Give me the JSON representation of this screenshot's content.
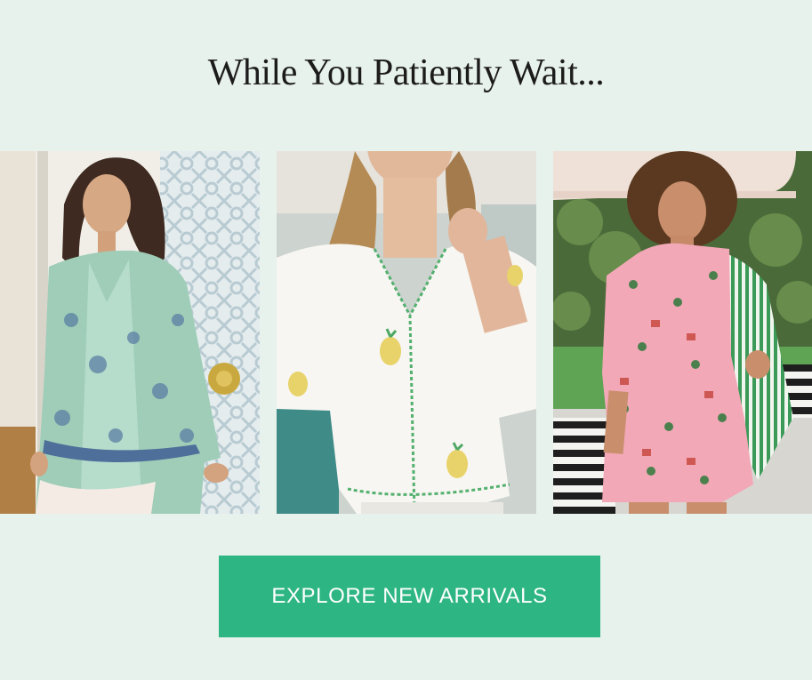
{
  "headline": "While You Patiently Wait...",
  "cta": {
    "label": "EXPLORE NEW ARRIVALS"
  },
  "colors": {
    "background": "#e8f2ec",
    "cta_background": "#2db683",
    "cta_text": "#ffffff",
    "headline_text": "#1c1c1c"
  }
}
